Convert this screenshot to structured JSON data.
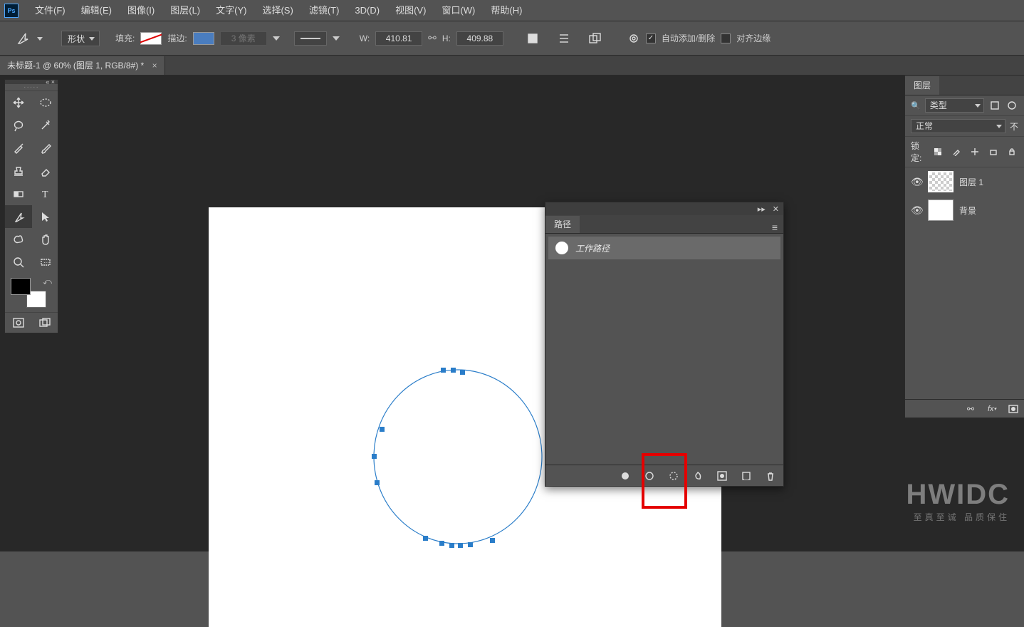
{
  "app_logo_text": "Ps",
  "menu": [
    "文件(F)",
    "编辑(E)",
    "图像(I)",
    "图层(L)",
    "文字(Y)",
    "选择(S)",
    "滤镜(T)",
    "3D(D)",
    "视图(V)",
    "窗口(W)",
    "帮助(H)"
  ],
  "options": {
    "mode_label": "形状",
    "fill_label": "填充:",
    "stroke_label": "描边:",
    "stroke_width_placeholder": "3 像素",
    "w_label": "W:",
    "w_value": "410.81",
    "h_label": "H:",
    "h_value": "409.88",
    "auto_add_delete": "自动添加/删除",
    "align_edges": "对齐边缘"
  },
  "doc_tab_title": "未标题-1 @ 60% (图层 1, RGB/8#) *",
  "paths_panel": {
    "tab": "路径",
    "row_name": "工作路径"
  },
  "layers_panel": {
    "tab": "图层",
    "type_filter": "类型",
    "blend_mode": "正常",
    "opacity_label_partial": "不",
    "lock_label": "锁定:",
    "layers": [
      {
        "name": "图层 1",
        "selected": true,
        "checker": true
      },
      {
        "name": "背景",
        "selected": false,
        "checker": false
      }
    ]
  },
  "watermark": {
    "big": "HWIDC",
    "small": "至真至诚 品质保住"
  }
}
